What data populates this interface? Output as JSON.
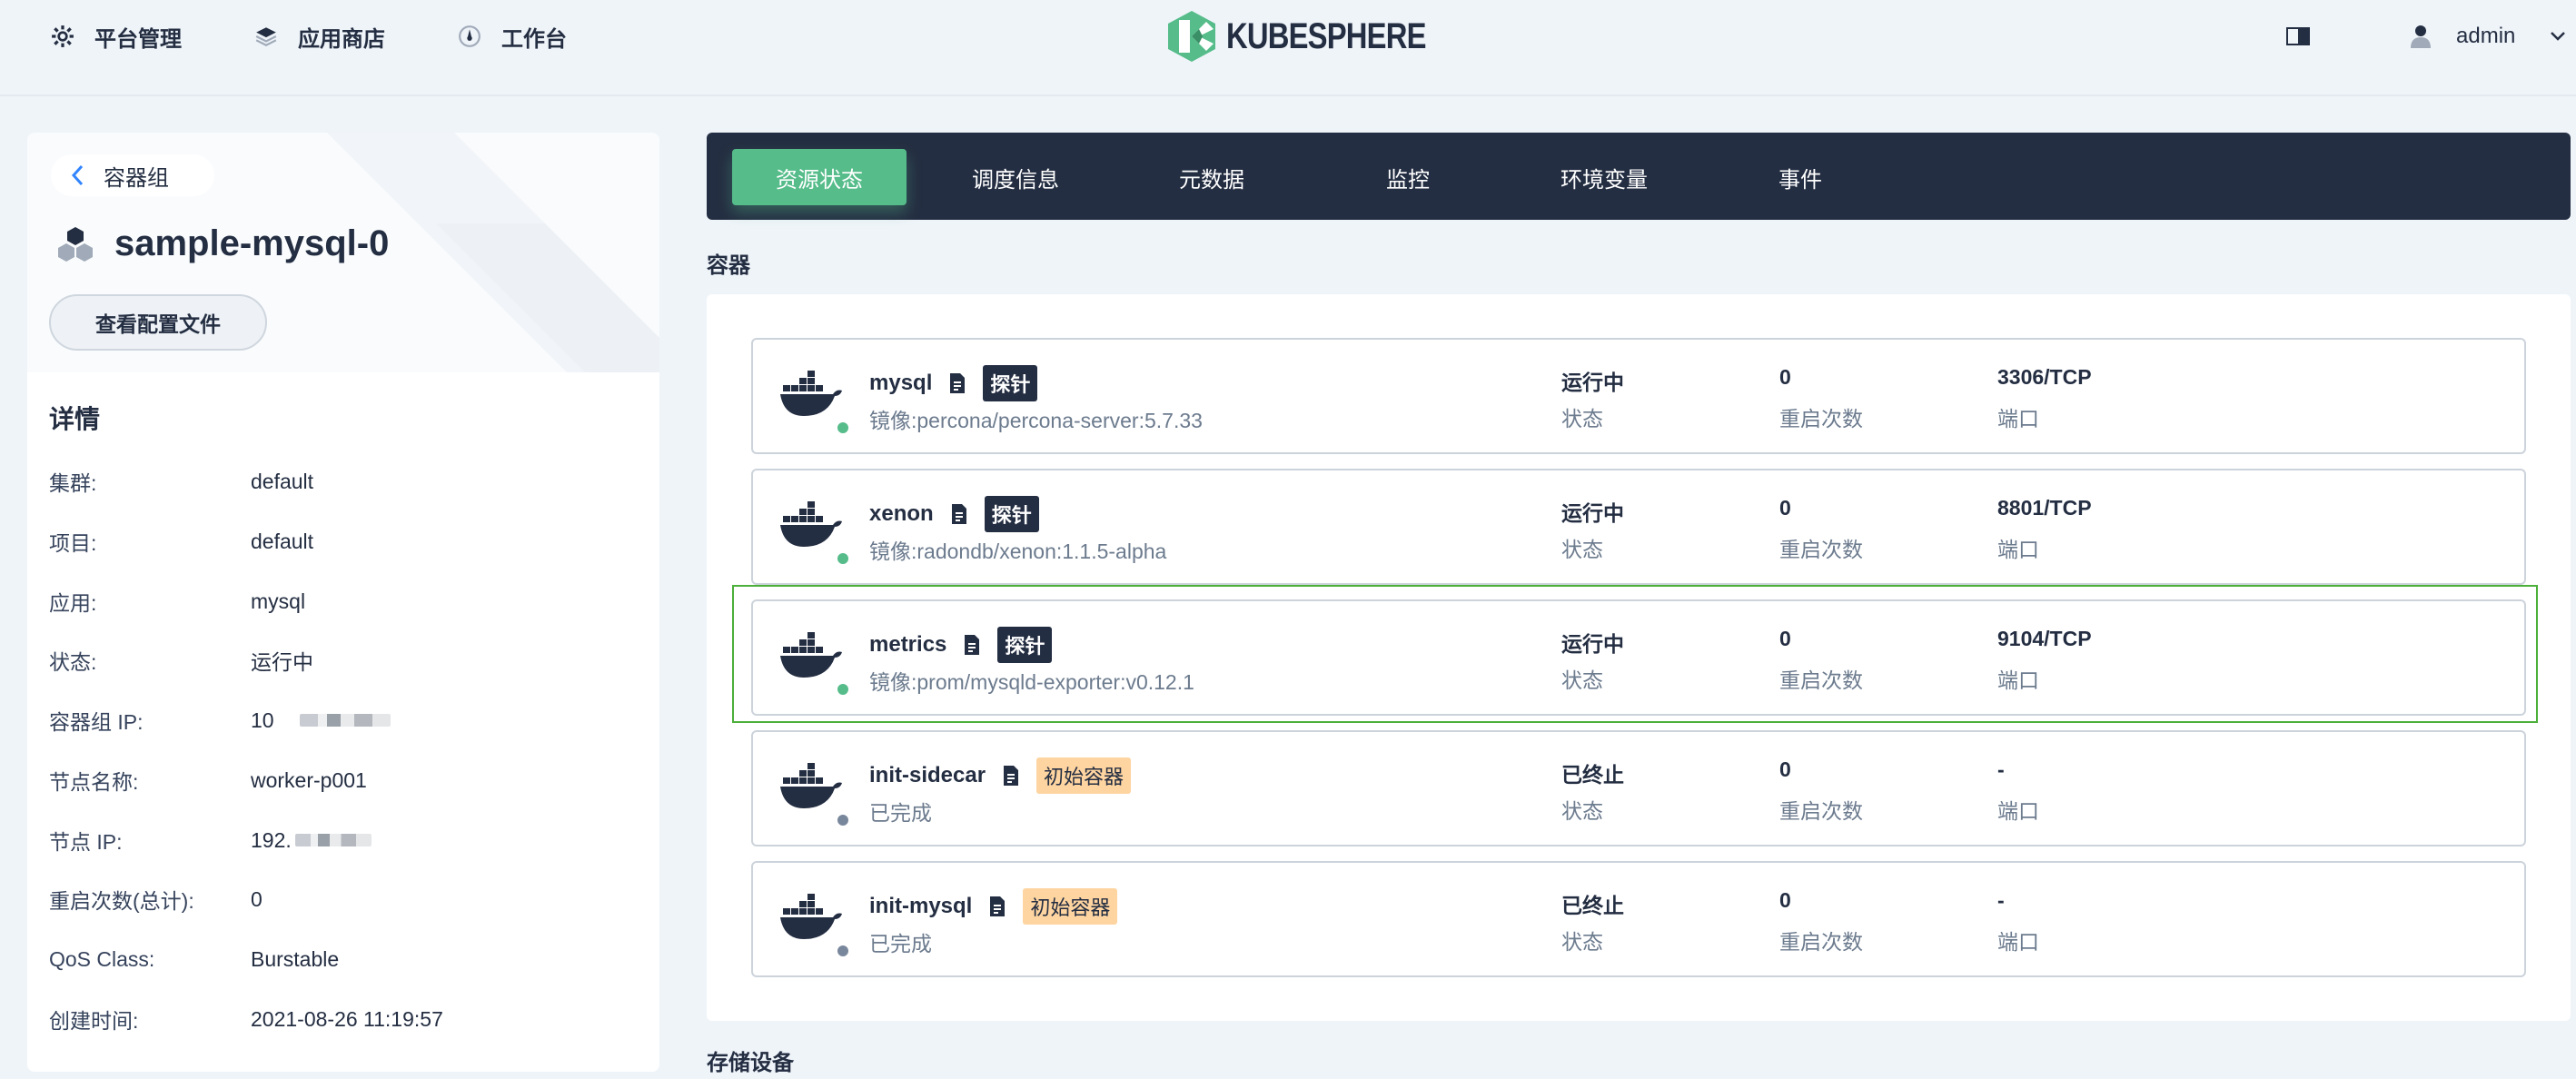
{
  "nav": {
    "platform": "平台管理",
    "appstore": "应用商店",
    "workbench": "工作台",
    "logo": "KUBESPHERE",
    "user": "admin"
  },
  "pod": {
    "back_label": "容器组",
    "name": "sample-mysql-0",
    "view_config": "查看配置文件"
  },
  "details": {
    "title": "详情",
    "rows": [
      {
        "k": "集群:",
        "v": "default"
      },
      {
        "k": "项目:",
        "v": "default"
      },
      {
        "k": "应用:",
        "v": "mysql"
      },
      {
        "k": "状态:",
        "v": "运行中"
      },
      {
        "k": "容器组 IP:",
        "v": "10"
      },
      {
        "k": "节点名称:",
        "v": "worker-p001"
      },
      {
        "k": "节点 IP:",
        "v": "192."
      },
      {
        "k": "重启次数(总计):",
        "v": "0"
      },
      {
        "k": "QoS Class:",
        "v": "Burstable"
      },
      {
        "k": "创建时间:",
        "v": "2021-08-26 11:19:57"
      }
    ]
  },
  "tabs": [
    "资源状态",
    "调度信息",
    "元数据",
    "监控",
    "环境变量",
    "事件"
  ],
  "sections": {
    "containers": "容器",
    "storage": "存储设备"
  },
  "labels": {
    "status": "状态",
    "restarts": "重启次数",
    "port": "端口"
  },
  "containers": [
    {
      "name": "mysql",
      "badge": "探针",
      "badge_type": "probe",
      "image": "镜像:percona/percona-server:5.7.33",
      "status": "运行中",
      "restarts": "0",
      "port": "3306/TCP",
      "dot_color": "#55bc8a"
    },
    {
      "name": "xenon",
      "badge": "探针",
      "badge_type": "probe",
      "image": "镜像:radondb/xenon:1.1.5-alpha",
      "status": "运行中",
      "restarts": "0",
      "port": "8801/TCP",
      "dot_color": "#55bc8a"
    },
    {
      "name": "metrics",
      "badge": "探针",
      "badge_type": "probe",
      "image": "镜像:prom/mysqld-exporter:v0.12.1",
      "status": "运行中",
      "restarts": "0",
      "port": "9104/TCP",
      "dot_color": "#55bc8a"
    },
    {
      "name": "init-sidecar",
      "badge": "初始容器",
      "badge_type": "init",
      "image": "已完成",
      "status": "已终止",
      "restarts": "0",
      "port": "-",
      "dot_color": "#79879c"
    },
    {
      "name": "init-mysql",
      "badge": "初始容器",
      "badge_type": "init",
      "image": "已完成",
      "status": "已终止",
      "restarts": "0",
      "port": "-",
      "dot_color": "#79879c"
    }
  ],
  "colors": {
    "accent": "#55bc8a",
    "dark": "#242e42",
    "init_badge": "#fed4a0"
  }
}
